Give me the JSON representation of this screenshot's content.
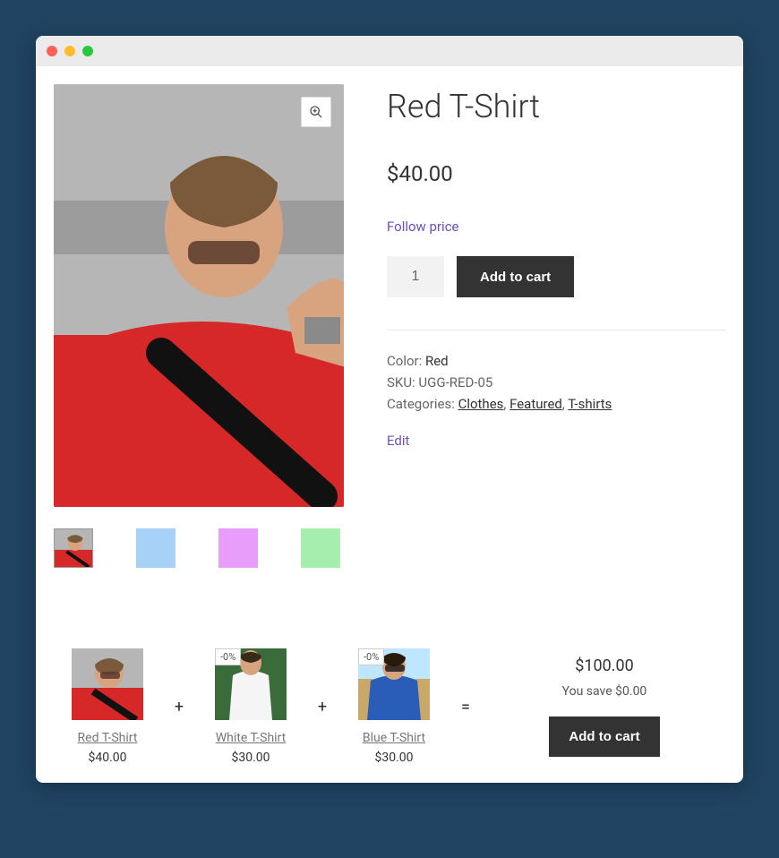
{
  "product": {
    "title": "Red T-Shirt",
    "price": "$40.00",
    "follow_label": "Follow price",
    "quantity": "1",
    "add_to_cart_label": "Add to cart",
    "color_label": "Color:",
    "color_value": "Red",
    "sku_label": "SKU:",
    "sku_value": "UGG-RED-05",
    "categories_label": "Categories:",
    "categories": [
      "Clothes",
      "Featured",
      "T-shirts"
    ],
    "edit_label": "Edit"
  },
  "thumbnails": [
    {
      "name": "red",
      "color": "#d62828"
    },
    {
      "name": "blue",
      "color": "#a7d1f7"
    },
    {
      "name": "pink",
      "color": "#e79df9"
    },
    {
      "name": "green",
      "color": "#a5eeae"
    }
  ],
  "bundle": {
    "items": [
      {
        "name": "Red T-Shirt",
        "price": "$40.00",
        "badge": null,
        "color": "#d62828"
      },
      {
        "name": "White T-Shirt",
        "price": "$30.00",
        "badge": "-0%",
        "color": "#ffffff"
      },
      {
        "name": "Blue T-Shirt",
        "price": "$30.00",
        "badge": "-0%",
        "color": "#2a5db8"
      }
    ],
    "total": "$100.00",
    "save_text": "You save $0.00",
    "add_label": "Add to cart"
  }
}
